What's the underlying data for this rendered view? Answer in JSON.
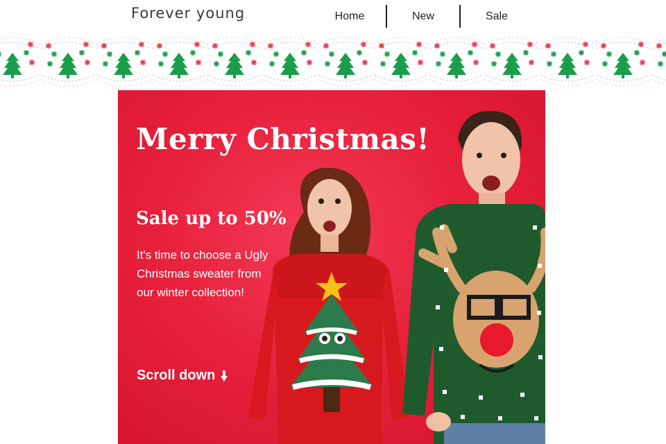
{
  "header": {
    "logo": "Forever young",
    "nav": [
      {
        "label": "Home"
      },
      {
        "label": "New"
      },
      {
        "label": "Sale"
      }
    ]
  },
  "hero": {
    "title": "Merry Christmas!",
    "subtitle": "Sale up to 50%",
    "text": "It's time to choose a Ugly Christmas sweater from our winter collection!",
    "cta_label": "Scroll down",
    "background_color": "#e8213d"
  },
  "decor": {
    "border_icons": [
      "tree-icon",
      "snowflake-icon"
    ],
    "tree_color": "#1b9e4b",
    "snowflake_color": "#e63d5a"
  },
  "icons": {
    "scroll": "arrow-down-icon"
  }
}
